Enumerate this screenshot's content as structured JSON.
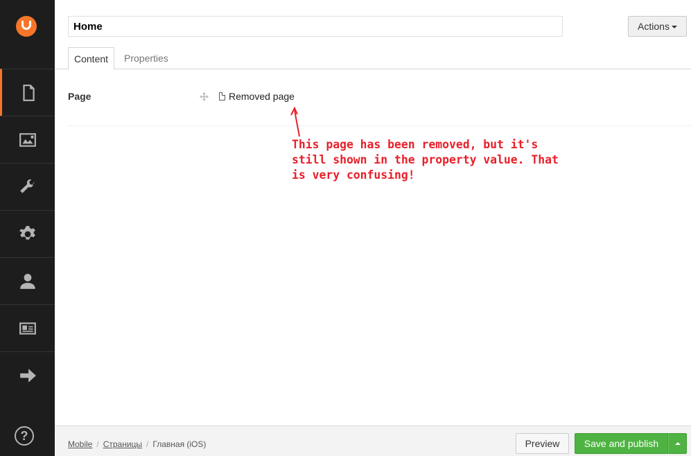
{
  "header": {
    "name_value": "Home",
    "actions_label": "Actions"
  },
  "tabs": [
    {
      "label": "Content"
    },
    {
      "label": "Properties"
    }
  ],
  "property": {
    "label": "Page",
    "node_name": "Removed page"
  },
  "annotation": {
    "text": "This page has been removed, but it's\nstill shown in the property value. That\nis very confusing!",
    "color": "#e8202a"
  },
  "breadcrumb": {
    "items": [
      "Mobile",
      "Страницы",
      "Главная (iOS)"
    ]
  },
  "footer": {
    "preview_label": "Preview",
    "publish_label": "Save and publish"
  },
  "sidebar": {
    "icons": [
      "content-icon",
      "media-icon",
      "developer-icon",
      "settings-icon",
      "users-icon",
      "members-icon",
      "forms-icon"
    ]
  },
  "colors": {
    "accent": "#f5762b",
    "publish": "#4eb342",
    "sidebar": "#1d1d1d"
  }
}
